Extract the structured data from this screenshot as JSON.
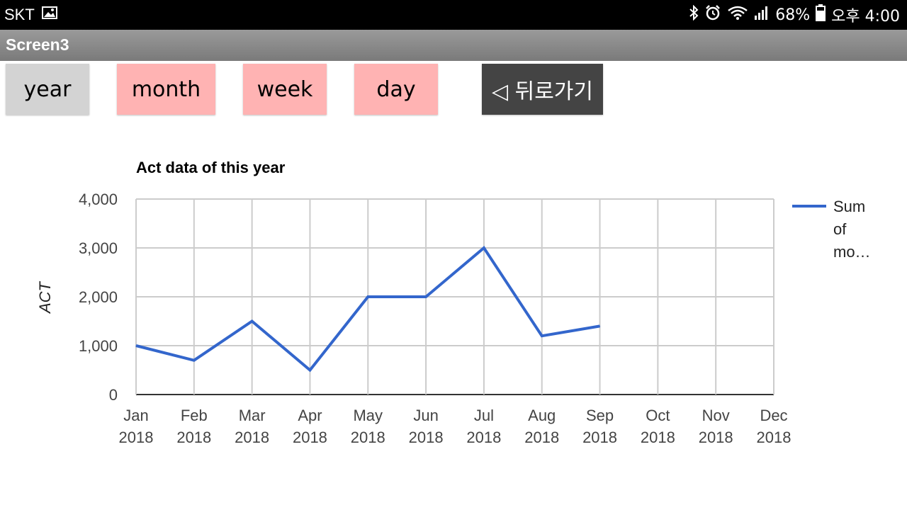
{
  "status_bar": {
    "carrier": "SKT",
    "battery": "68%",
    "time": "오후 4:00",
    "icons": [
      "image-icon",
      "bluetooth-icon",
      "alarm-icon",
      "wifi-icon",
      "signal-icon",
      "battery-icon"
    ]
  },
  "title_bar": {
    "title": "Screen3"
  },
  "toolbar": {
    "year_label": "year",
    "month_label": "month",
    "week_label": "week",
    "day_label": "day",
    "back_label": "◁ 뒤로가기",
    "colors": {
      "selected": "#d3d3d3",
      "unselected": "#ffb3b3",
      "back": "#444444"
    }
  },
  "chart_data": {
    "type": "line",
    "title": "Act data of this year",
    "ylabel": "ACT",
    "xlabel": "",
    "categories": [
      "Jan 2018",
      "Feb 2018",
      "Mar 2018",
      "Apr 2018",
      "May 2018",
      "Jun 2018",
      "Jul 2018",
      "Aug 2018",
      "Sep 2018",
      "Oct 2018",
      "Nov 2018",
      "Dec 2018"
    ],
    "series": [
      {
        "name": "Sum of mo…",
        "values": [
          1000,
          700,
          1500,
          500,
          2000,
          2000,
          3000,
          1200,
          1400,
          null,
          null,
          null
        ],
        "color": "#3366cc"
      }
    ],
    "ylim": [
      0,
      4000
    ],
    "yticks": [
      "0",
      "1,000",
      "2,000",
      "3,000",
      "4,000"
    ],
    "grid": true,
    "legend": "right"
  }
}
